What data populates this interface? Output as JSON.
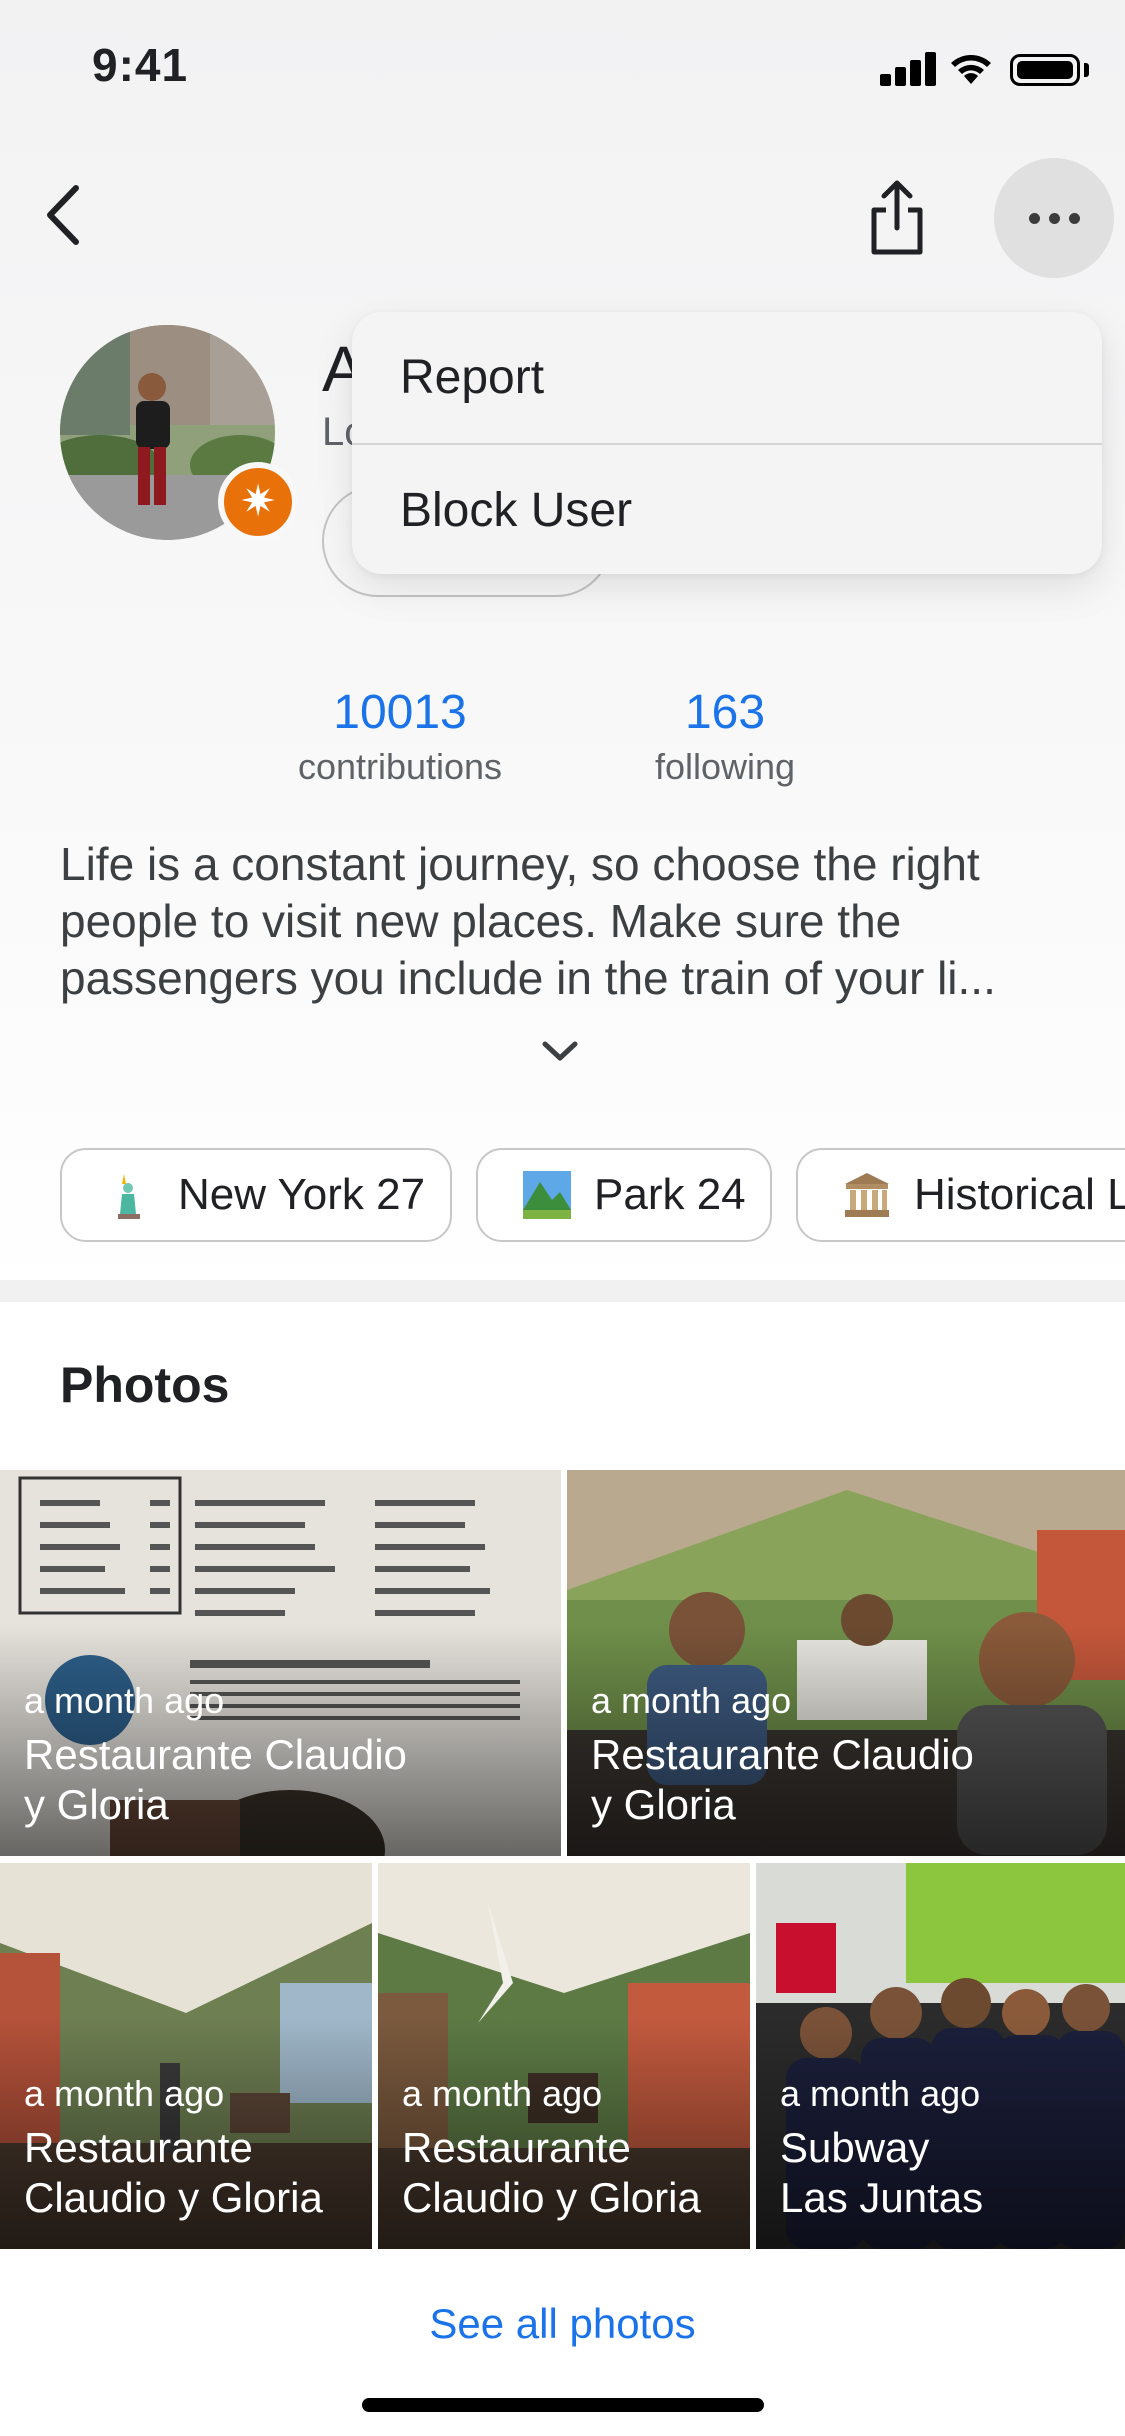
{
  "status_bar": {
    "time": "9:41"
  },
  "menu": {
    "items": [
      "Report",
      "Block User"
    ]
  },
  "profile": {
    "name_fragment": "A",
    "subtitle_fragment": "Lo"
  },
  "stats": [
    {
      "value": "10013",
      "label": "contributions"
    },
    {
      "value": "163",
      "label": "following"
    }
  ],
  "bio": "Life is a constant journey, so choose the right people to visit new places. Make sure the passengers you include in the train of your li...",
  "chips": [
    {
      "icon": "statue-of-liberty-icon",
      "label": "New York 27"
    },
    {
      "icon": "park-icon",
      "label": "Park 24"
    },
    {
      "icon": "historical-landmark-icon",
      "label": "Historical L"
    }
  ],
  "photos": {
    "title": "Photos",
    "items": [
      {
        "when": "a month ago",
        "place_line1": "Restaurante Claudio",
        "place_line2": "y Gloria"
      },
      {
        "when": "a month ago",
        "place_line1": "Restaurante Claudio",
        "place_line2": "y Gloria"
      },
      {
        "when": "a month ago",
        "place_line1": "Restaurante",
        "place_line2": "Claudio y Gloria"
      },
      {
        "when": "a month ago",
        "place_line1": "Restaurante",
        "place_line2": "Claudio y Gloria"
      },
      {
        "when": "a month ago",
        "place_line1": "Subway",
        "place_line2": "Las Juntas"
      }
    ],
    "see_all": "See all photos"
  },
  "colors": {
    "link": "#1a73e8",
    "badge": "#e8710a",
    "text": "#202124",
    "secondary": "#5f6368"
  }
}
